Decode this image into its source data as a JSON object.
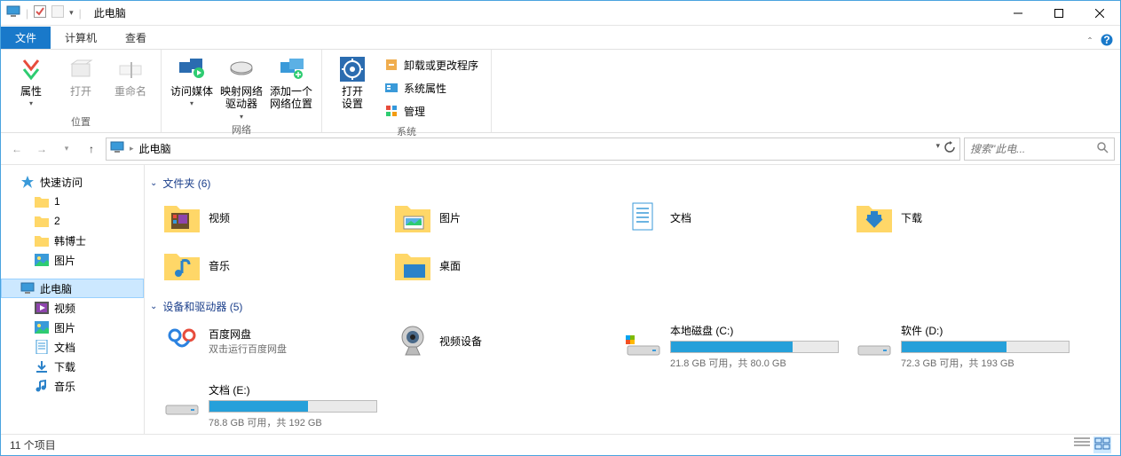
{
  "window": {
    "title": "此电脑"
  },
  "tabs": {
    "file": "文件",
    "computer": "计算机",
    "view": "查看"
  },
  "ribbon": {
    "groups": {
      "location": {
        "label": "位置",
        "properties": "属性",
        "open": "打开",
        "rename": "重命名"
      },
      "network": {
        "label": "网络",
        "media": "访问媒体",
        "map_drive": "映射网络\n驱动器",
        "add_location": "添加一个\n网络位置"
      },
      "system": {
        "label": "系统",
        "open_settings": "打开\n设置",
        "uninstall": "卸载或更改程序",
        "sys_props": "系统属性",
        "manage": "管理"
      }
    }
  },
  "address": {
    "crumb": "此电脑"
  },
  "search": {
    "placeholder": "搜索\"此电..."
  },
  "nav": {
    "quick_access": "快速访问",
    "items": [
      "1",
      "2",
      "韩博士",
      "图片"
    ],
    "this_pc": "此电脑",
    "pc_items": [
      "视频",
      "图片",
      "文档",
      "下载",
      "音乐"
    ]
  },
  "sections": {
    "folders": {
      "title": "文件夹 (6)",
      "items": [
        "视频",
        "图片",
        "文档",
        "下载",
        "音乐",
        "桌面"
      ]
    },
    "devices": {
      "title": "设备和驱动器 (5)",
      "baidu": {
        "name": "百度网盘",
        "sub": "双击运行百度网盘"
      },
      "camera": {
        "name": "视频设备"
      },
      "drives": [
        {
          "name": "本地磁盘 (C:)",
          "free": "21.8 GB 可用，共 80.0 GB",
          "pct": 73
        },
        {
          "name": "软件 (D:)",
          "free": "72.3 GB 可用，共 193 GB",
          "pct": 63
        },
        {
          "name": "文档 (E:)",
          "free": "78.8 GB 可用，共 192 GB",
          "pct": 59
        }
      ]
    }
  },
  "status": {
    "count": "11 个项目"
  }
}
